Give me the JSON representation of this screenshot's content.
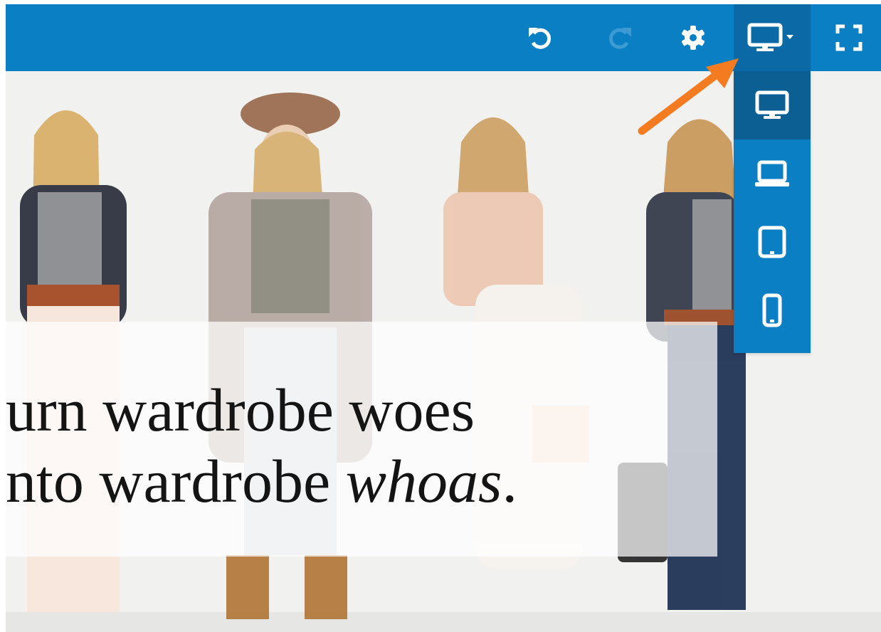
{
  "toolbar": {
    "undo_icon": "undo-icon",
    "redo_icon": "redo-icon",
    "settings_icon": "gear-icon",
    "device_icon": "desktop-icon",
    "fullscreen_icon": "fullscreen-icon"
  },
  "device_menu": {
    "items": [
      {
        "icon": "desktop-icon",
        "selected": true
      },
      {
        "icon": "laptop-icon",
        "selected": false
      },
      {
        "icon": "tablet-icon",
        "selected": false
      },
      {
        "icon": "phone-icon",
        "selected": false
      }
    ]
  },
  "hero": {
    "line1": "urn wardrobe woes",
    "line2_prefix": "nto wardrobe ",
    "line2_emphasis": "whoas",
    "line2_suffix": "."
  },
  "colors": {
    "toolbar": "#0a7fc3",
    "selected_item": "#0b5f93",
    "arrow": "#f47b20"
  }
}
